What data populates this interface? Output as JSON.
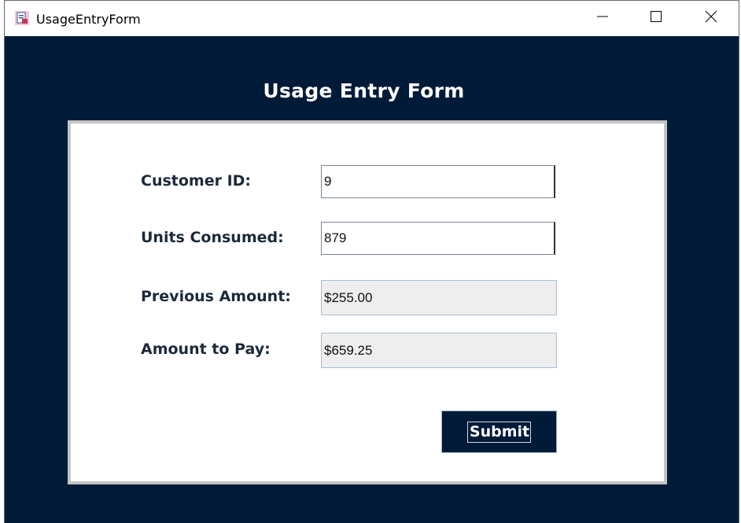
{
  "window": {
    "title": "UsageEntryForm",
    "icon": "app-form-icon",
    "controls": [
      "minimize-icon",
      "maximize-icon",
      "close-icon"
    ]
  },
  "form": {
    "heading": "Usage Entry Form",
    "fields": [
      {
        "label": "Customer ID:",
        "value": "9",
        "editable": true
      },
      {
        "label": "Units Consumed:",
        "value": "879",
        "editable": true
      },
      {
        "label": "Previous Amount:",
        "value": "$255.00",
        "editable": false
      },
      {
        "label": "Amount to Pay:",
        "value": "$659.25",
        "editable": false
      }
    ],
    "submit_label": "Submit"
  },
  "colors": {
    "background": "#001b38",
    "panel": "#ffffff",
    "panel_border": "#c4c4c4",
    "readonly_field": "#eeeeee"
  }
}
